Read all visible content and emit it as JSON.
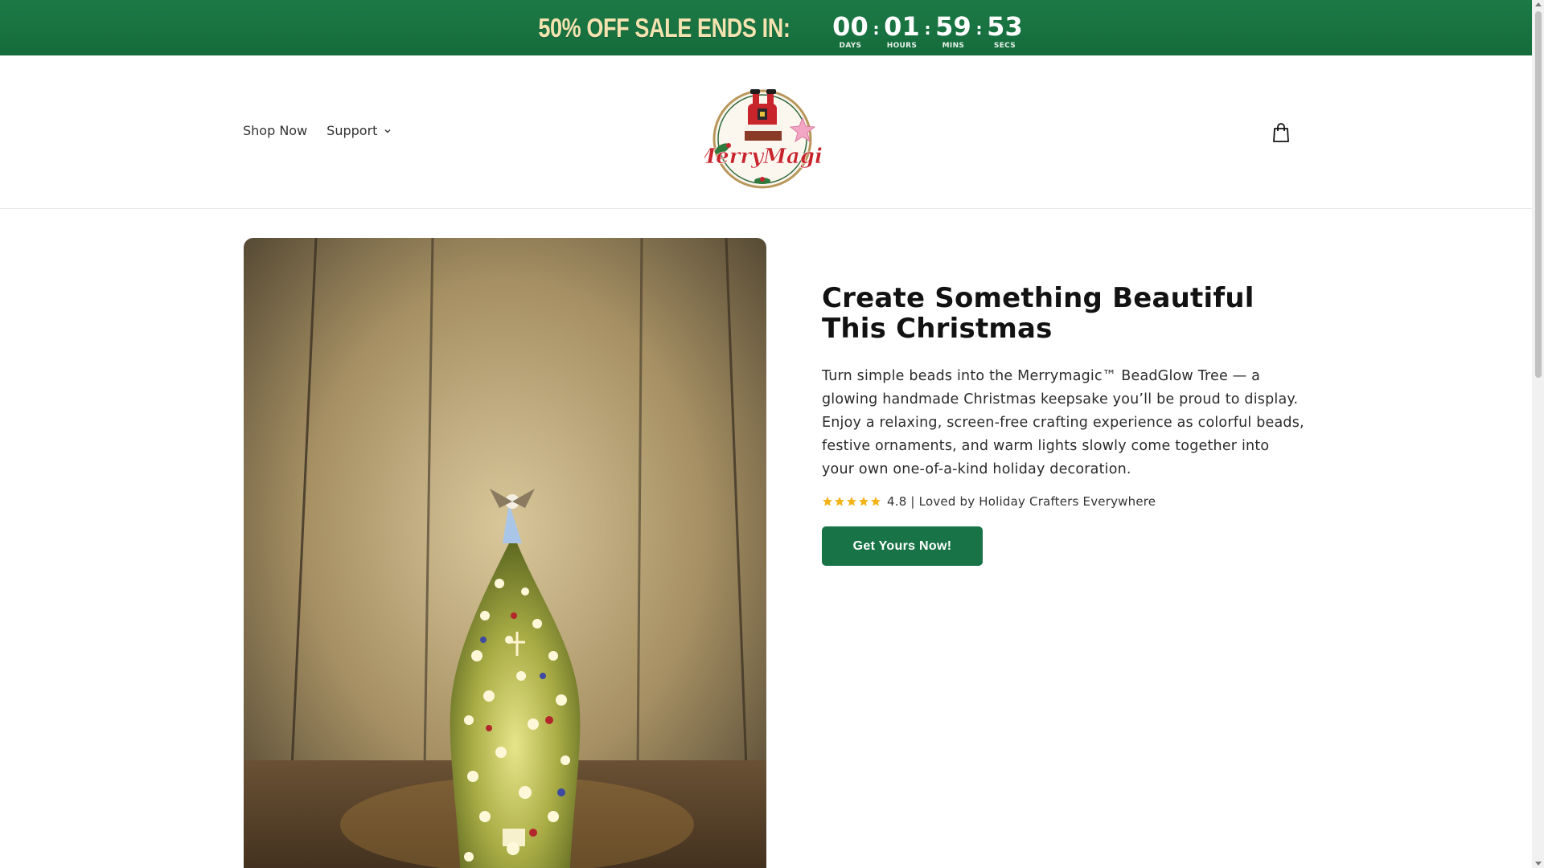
{
  "promo": {
    "text": "50% OFF SALE ENDS IN:",
    "countdown": [
      {
        "value": "00",
        "label": "DAYS"
      },
      {
        "value": "01",
        "label": "HOURS"
      },
      {
        "value": "59",
        "label": "MINS"
      },
      {
        "value": "53",
        "label": "SECS"
      }
    ],
    "separator": ":"
  },
  "header": {
    "nav": [
      {
        "label": "Shop Now"
      },
      {
        "label": "Support"
      }
    ],
    "logo_text": "MerryMagic",
    "cart_icon": "shopping-bag-icon"
  },
  "hero": {
    "title": "Create Something Beautiful This Christmas",
    "description": "Turn simple beads into the Merrymagic™ BeadGlow Tree — a glowing handmade Christmas keepsake you’ll be proud to display. Enjoy a relaxing, screen-free crafting experience as colorful beads, festive ornaments, and warm lights slowly come together into your own one-of-a-kind holiday decoration.",
    "rating_text": "4.8 | Loved by Holiday Crafters Everywhere",
    "rating_value": 4.8,
    "stars": 5,
    "cta_label": "Get Yours Now!"
  },
  "colors": {
    "brand_green": "#187447",
    "promo_bg": "#1a7444",
    "promo_text": "#f3e3b0",
    "star": "#f2b418"
  }
}
